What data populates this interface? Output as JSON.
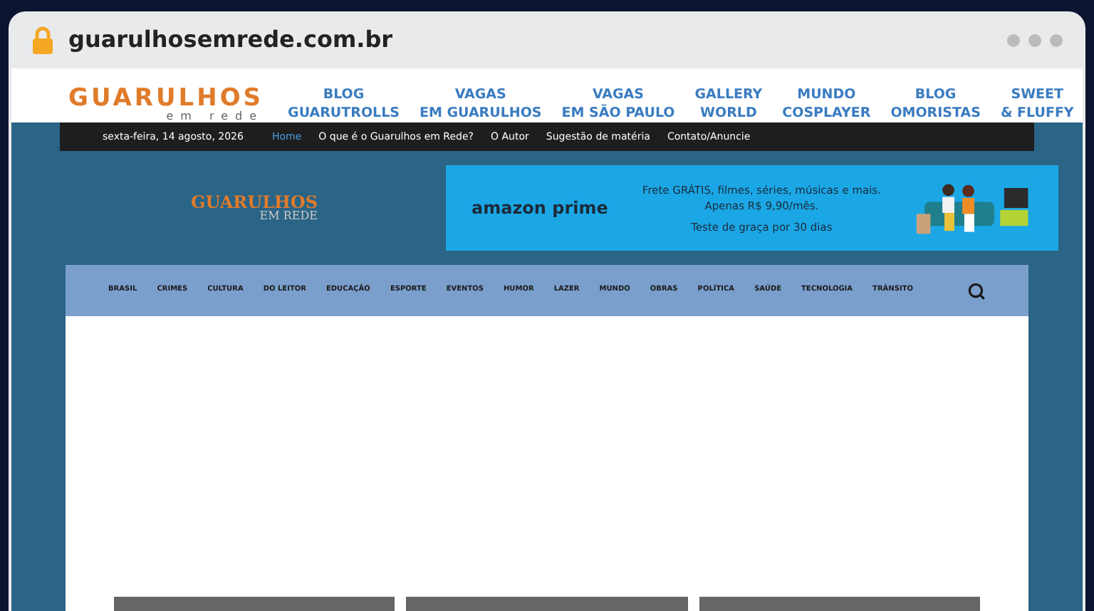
{
  "address_bar": {
    "url": "guarulhosemrede.com.br"
  },
  "header": {
    "logo": {
      "title": "GUARULHOS",
      "subtitle": "em rede"
    },
    "links": [
      {
        "line1": "BLOG",
        "line2": "GUARUTROLLS"
      },
      {
        "line1": "VAGAS",
        "line2": "EM GUARULHOS"
      },
      {
        "line1": "VAGAS",
        "line2": "EM SÃO PAULO"
      },
      {
        "line1": "GALLERY",
        "line2": "WORLD"
      },
      {
        "line1": "MUNDO",
        "line2": "COSPLAYER"
      },
      {
        "line1": "BLOG",
        "line2": "OMORISTAS"
      },
      {
        "line1": "SWEET",
        "line2": "& FLUFFY"
      }
    ]
  },
  "top_bar": {
    "date": "sexta-feira, 14 agosto, 2026",
    "menu": [
      {
        "label": "Home",
        "selected": true
      },
      {
        "label": "O que é o Guarulhos em Rede?",
        "selected": false
      },
      {
        "label": "O Autor",
        "selected": false
      },
      {
        "label": "Sugestão de matéria",
        "selected": false
      },
      {
        "label": "Contato/Anuncie",
        "selected": false
      }
    ]
  },
  "site_logo": {
    "title": "GUARULHOS",
    "subtitle": "EM REDE"
  },
  "ad_banner": {
    "brand": "amazon prime",
    "line1": "Frete GRÁTIS, filmes, séries, músicas e mais.",
    "line2": "Apenas R$ 9,90/mês.",
    "line3": "Teste de graça por 30 dias"
  },
  "categories": [
    "BRASIL",
    "CRIMES",
    "CULTURA",
    "DO LEITOR",
    "EDUCAÇÃO",
    "ESPORTE",
    "EVENTOS",
    "HUMOR",
    "LAZER",
    "MUNDO",
    "OBRAS",
    "POLÍTICA",
    "SAÚDE",
    "TECNOLOGIA",
    "TRÂNSITO"
  ]
}
